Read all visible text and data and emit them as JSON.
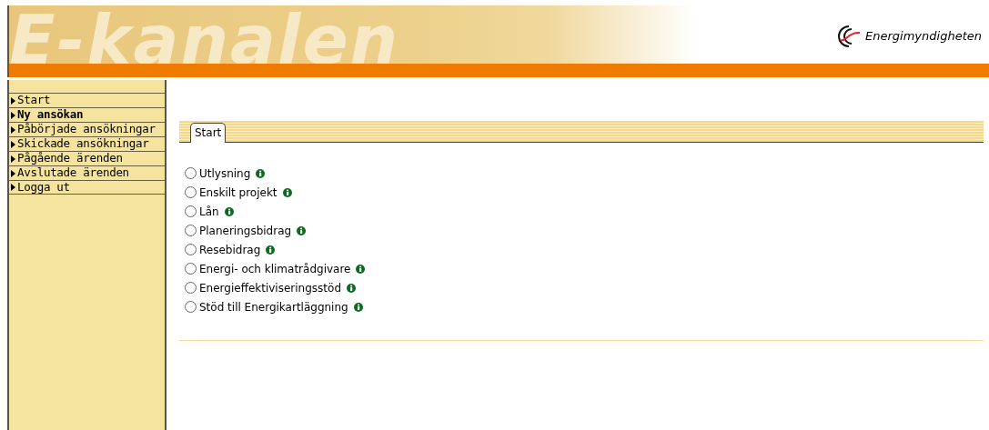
{
  "header": {
    "title": "E-kanalen",
    "logo_text": "Energimyndigheten"
  },
  "sidebar": {
    "items": [
      {
        "label": "Start",
        "selected": false
      },
      {
        "label": "Ny ansökan",
        "selected": true
      },
      {
        "label": "Påbörjade ansökningar",
        "selected": false
      },
      {
        "label": "Skickade ansökningar",
        "selected": false
      },
      {
        "label": "Pågående ärenden",
        "selected": false
      },
      {
        "label": "Avslutade ärenden",
        "selected": false
      },
      {
        "label": "Logga ut",
        "selected": false
      }
    ]
  },
  "tabs": [
    {
      "label": "Start",
      "selected": true
    }
  ],
  "options": [
    {
      "label": "Utlysning",
      "checked": false
    },
    {
      "label": "Enskilt projekt",
      "checked": false
    },
    {
      "label": "Lån",
      "checked": false
    },
    {
      "label": "Planeringsbidrag",
      "checked": false
    },
    {
      "label": "Resebidrag",
      "checked": false
    },
    {
      "label": "Energi- och klimatrådgivare",
      "checked": false
    },
    {
      "label": "Energieffektiviseringsstöd",
      "checked": false
    },
    {
      "label": "Stöd till Energikartläggning",
      "checked": false
    }
  ]
}
